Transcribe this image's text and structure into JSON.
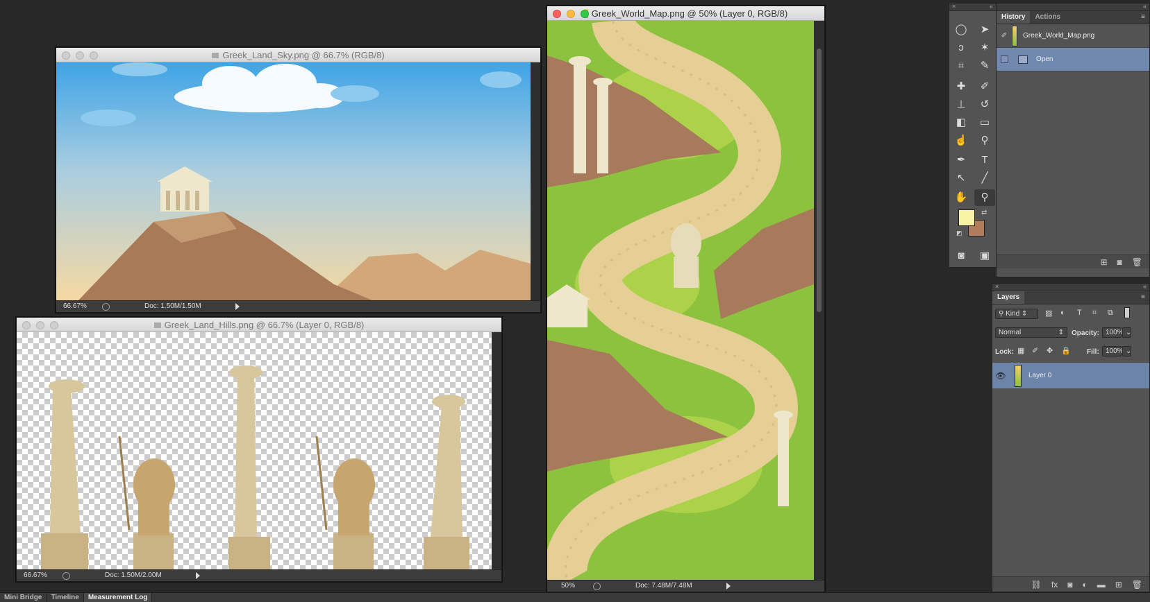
{
  "windows": {
    "sky": {
      "title": "Greek_Land_Sky.png @ 66.7% (RGB/8)",
      "zoom": "66.67%",
      "doc": "Doc: 1.50M/1.50M"
    },
    "hills": {
      "title": "Greek_Land_Hills.png @ 66.7% (Layer 0, RGB/8)",
      "zoom": "66.67%",
      "doc": "Doc: 1.50M/2.00M"
    },
    "map": {
      "title": "Greek_World_Map.png @ 50% (Layer 0, RGB/8)",
      "zoom": "50%",
      "doc": "Doc: 7.48M/7.48M"
    }
  },
  "tools": {
    "icons": [
      "elliptical-marquee-icon",
      "move-icon",
      "lasso-icon",
      "magic-wand-icon",
      "crop-icon",
      "eyedropper-icon",
      "healing-brush-icon",
      "brush-icon",
      "clone-stamp-icon",
      "history-brush-icon",
      "eraser-icon",
      "gradient-icon",
      "smudge-icon",
      "dodge-icon",
      "pen-icon",
      "type-icon",
      "path-selection-icon",
      "line-icon",
      "hand-icon",
      "zoom-icon"
    ],
    "foreground_color": "#f8f3a7",
    "background_color": "#b07c5c"
  },
  "history": {
    "tabs": [
      "History",
      "Actions"
    ],
    "snapshot": "Greek_World_Map.png",
    "items": [
      "Open"
    ]
  },
  "layers": {
    "title": "Layers",
    "kind": "Kind",
    "blend_mode": "Normal",
    "opacity_label": "Opacity:",
    "opacity": "100%",
    "lock_label": "Lock:",
    "fill_label": "Fill:",
    "fill": "100%",
    "items": [
      {
        "name": "Layer 0",
        "visible": true
      }
    ]
  },
  "bottom_tabs": [
    "Mini Bridge",
    "Timeline",
    "Measurement Log"
  ]
}
